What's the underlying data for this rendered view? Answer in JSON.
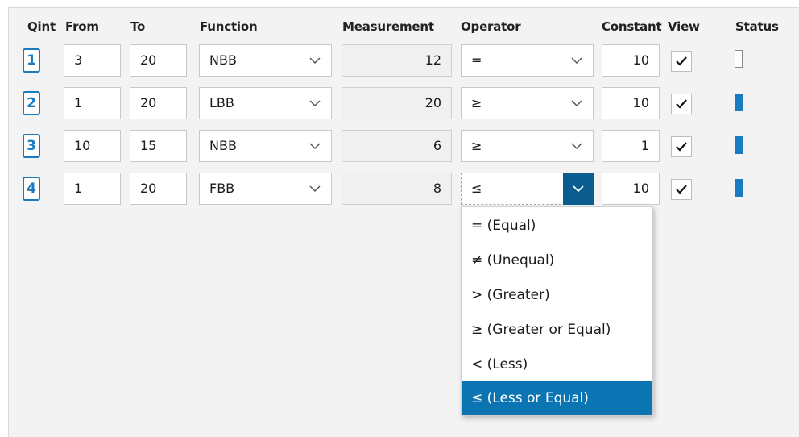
{
  "headers": {
    "qint": "Qint",
    "from": "From",
    "to": "To",
    "function": "Function",
    "measurement": "Measurement",
    "operator": "Operator",
    "constant": "Constant",
    "view": "View",
    "status": "Status"
  },
  "rows": [
    {
      "qint": "1",
      "from": "3",
      "to": "20",
      "function": "NBB",
      "measurement": "12",
      "operator": "=",
      "constant": "10",
      "view": true,
      "status": "inactive"
    },
    {
      "qint": "2",
      "from": "1",
      "to": "20",
      "function": "LBB",
      "measurement": "20",
      "operator": "≥",
      "constant": "10",
      "view": true,
      "status": "active"
    },
    {
      "qint": "3",
      "from": "10",
      "to": "15",
      "function": "NBB",
      "measurement": "6",
      "operator": "≥",
      "constant": "1",
      "view": true,
      "status": "active"
    },
    {
      "qint": "4",
      "from": "1",
      "to": "20",
      "function": "FBB",
      "measurement": "8",
      "operator": "≤",
      "constant": "10",
      "view": true,
      "status": "active"
    }
  ],
  "operator_dropdown": {
    "open_row": 4,
    "options": [
      "= (Equal)",
      "≠ (Unequal)",
      "> (Greater)",
      "≥ (Greater or Equal)",
      "< (Less)",
      "≤ (Less or Equal)"
    ],
    "selected_index": 5
  },
  "colors": {
    "accent": "#1a7bbf",
    "selected_bg": "#0b75b4",
    "active_button": "#0b5d8f"
  },
  "icons": {
    "dropdown": "chevron-down-icon",
    "view": "checkmark-icon"
  }
}
